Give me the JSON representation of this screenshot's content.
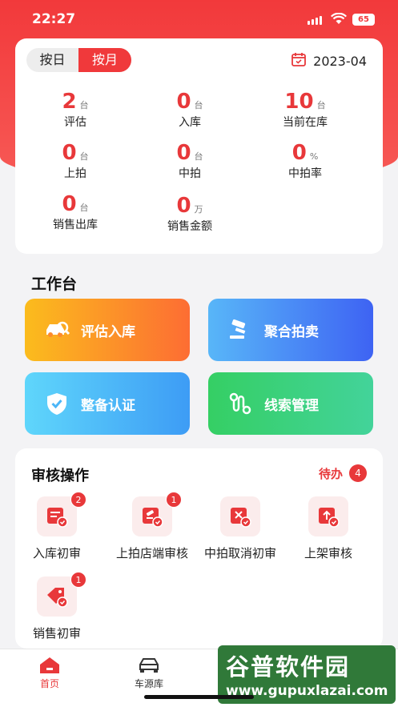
{
  "status": {
    "time": "22:27",
    "battery": "65"
  },
  "stats": {
    "seg_day": "按日",
    "seg_month": "按月",
    "date": "2023-04",
    "items": [
      {
        "num": "2",
        "unit": "台",
        "label": "评估"
      },
      {
        "num": "0",
        "unit": "台",
        "label": "入库"
      },
      {
        "num": "10",
        "unit": "台",
        "label": "当前在库"
      },
      {
        "num": "0",
        "unit": "台",
        "label": "上拍"
      },
      {
        "num": "0",
        "unit": "台",
        "label": "中拍"
      },
      {
        "num": "0",
        "unit": "%",
        "label": "中拍率"
      },
      {
        "num": "0",
        "unit": "台",
        "label": "销售出库"
      },
      {
        "num": "0",
        "unit": "万",
        "label": "销售金额"
      }
    ]
  },
  "workbench": {
    "title": "工作台",
    "tiles": [
      {
        "label": "评估入库",
        "icon": "car-search-icon"
      },
      {
        "label": "聚合拍卖",
        "icon": "gavel-icon"
      },
      {
        "label": "整备认证",
        "icon": "shield-check-icon"
      },
      {
        "label": "线索管理",
        "icon": "route-icon"
      }
    ]
  },
  "audit": {
    "title": "审核操作",
    "todo_label": "待办",
    "todo_count": "4",
    "items": [
      {
        "label": "入库初审",
        "badge": "2"
      },
      {
        "label": "上拍店端审核",
        "badge": "1"
      },
      {
        "label": "中拍取消初审",
        "badge": ""
      },
      {
        "label": "上架审核",
        "badge": ""
      },
      {
        "label": "销售初审",
        "badge": "1"
      }
    ]
  },
  "tabbar": {
    "home": "首页",
    "cars": "车源库"
  },
  "watermark": {
    "line1": "谷普软件园",
    "line2": "www.gupuxlazai.com"
  },
  "colors": {
    "accent": "#e8383a"
  }
}
